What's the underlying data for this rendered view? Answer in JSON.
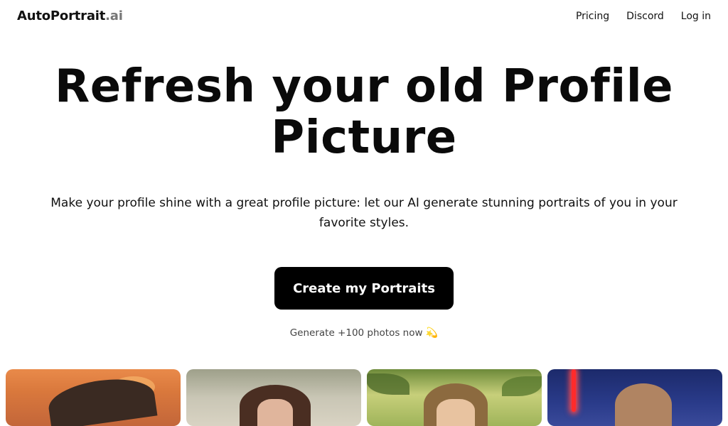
{
  "nav": {
    "logo_main": "AutoPortrait",
    "logo_tld": ".ai",
    "links": [
      "Pricing",
      "Discord",
      "Log in"
    ]
  },
  "hero": {
    "title": "Refresh your old Profile Picture",
    "subtitle": "Make your profile shine with a great profile picture: let our AI generate stunning portraits of you in your favorite styles.",
    "cta_label": "Create my Portraits",
    "cta_note": "Generate +100 photos now",
    "cta_note_emoji": "💫"
  },
  "gallery": {
    "images": [
      "portrait-anime-sunset",
      "portrait-woman-outdoor",
      "portrait-jungle",
      "portrait-lightsaber"
    ]
  }
}
